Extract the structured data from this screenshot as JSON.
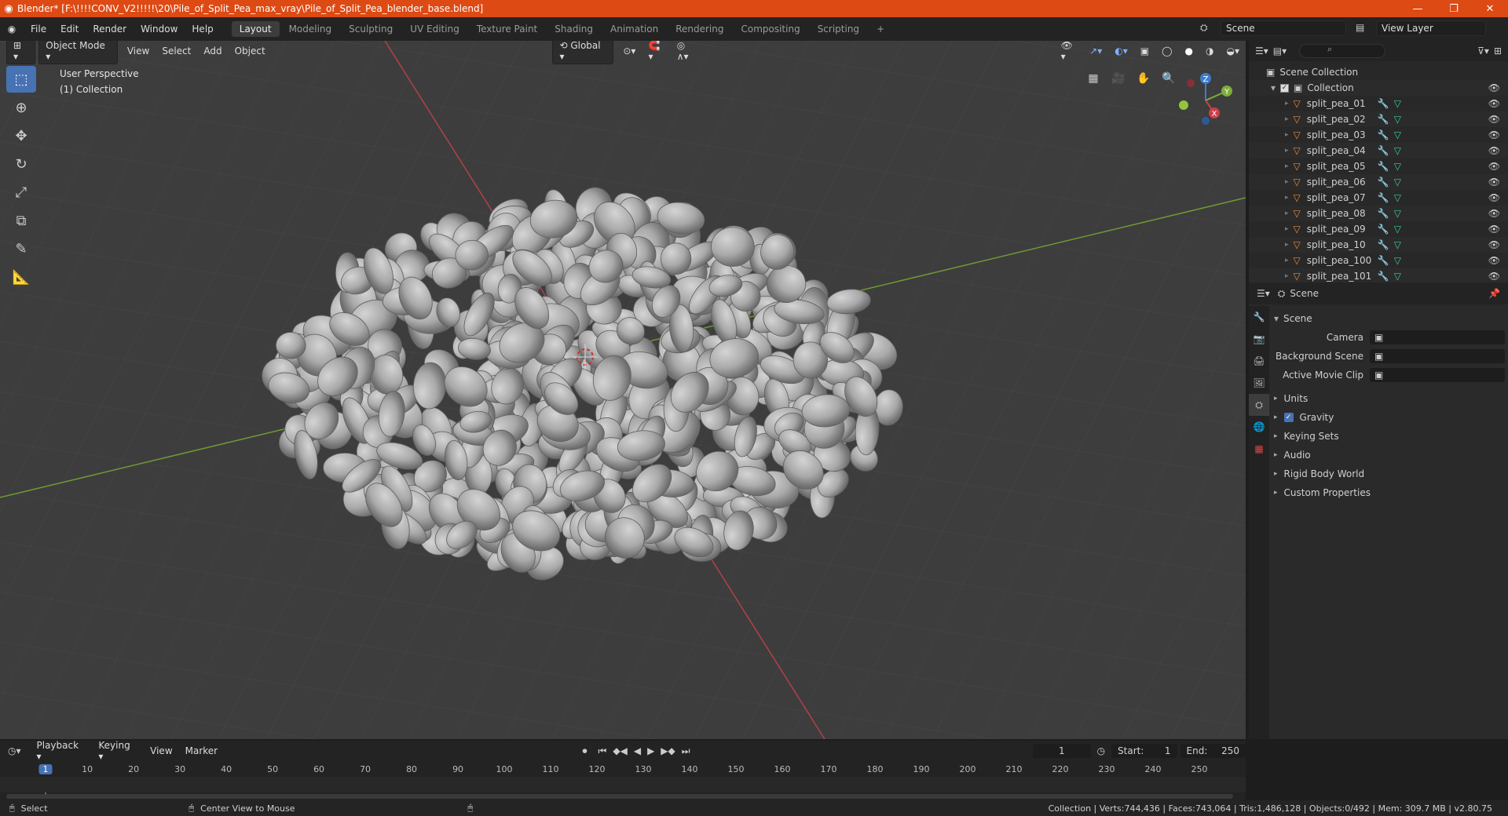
{
  "titlebar": {
    "title": "Blender* [F:\\!!!!CONV_V2!!!!!\\20\\Pile_of_Split_Pea_max_vray\\Pile_of_Split_Pea_blender_base.blend]",
    "minimize": "—",
    "maximize": "❐",
    "close": "✕"
  },
  "topbar": {
    "menus": [
      "File",
      "Edit",
      "Render",
      "Window",
      "Help"
    ],
    "workspaces": [
      "Layout",
      "Modeling",
      "Sculpting",
      "UV Editing",
      "Texture Paint",
      "Shading",
      "Animation",
      "Rendering",
      "Compositing",
      "Scripting"
    ],
    "active_workspace": "Layout",
    "add_tab": "+",
    "scene": "Scene",
    "view_layer": "View Layer"
  },
  "viewport": {
    "mode": "Object Mode",
    "menus": [
      "View",
      "Select",
      "Add",
      "Object"
    ],
    "orientation": "Global",
    "perspective_label": "User Perspective",
    "collection_label": "(1) Collection",
    "gizmo": {
      "x": "X",
      "y": "Y",
      "z": "Z"
    }
  },
  "outliner": {
    "search_placeholder": "",
    "root": "Scene Collection",
    "collection": "Collection",
    "items": [
      "split_pea_01",
      "split_pea_02",
      "split_pea_03",
      "split_pea_04",
      "split_pea_05",
      "split_pea_06",
      "split_pea_07",
      "split_pea_08",
      "split_pea_09",
      "split_pea_10",
      "split_pea_100",
      "split_pea_101"
    ]
  },
  "properties": {
    "header": "Scene",
    "section": "Scene",
    "fields": [
      {
        "label": "Camera",
        "value": ""
      },
      {
        "label": "Background Scene",
        "value": ""
      },
      {
        "label": "Active Movie Clip",
        "value": ""
      }
    ],
    "panels": [
      {
        "label": "Units",
        "checkbox": false
      },
      {
        "label": "Gravity",
        "checkbox": true
      },
      {
        "label": "Keying Sets",
        "checkbox": false
      },
      {
        "label": "Audio",
        "checkbox": false
      },
      {
        "label": "Rigid Body World",
        "checkbox": false
      },
      {
        "label": "Custom Properties",
        "checkbox": false
      }
    ]
  },
  "timeline": {
    "menus": [
      "Playback",
      "Keying",
      "View",
      "Marker"
    ],
    "current_frame": "1",
    "start_label": "Start:",
    "start": "1",
    "end_label": "End:",
    "end": "250",
    "ticks": [
      "1",
      "10",
      "20",
      "30",
      "40",
      "50",
      "60",
      "70",
      "80",
      "90",
      "100",
      "110",
      "120",
      "130",
      "140",
      "150",
      "160",
      "170",
      "180",
      "190",
      "200",
      "210",
      "220",
      "230",
      "240",
      "250"
    ]
  },
  "statusbar": {
    "left": "Select",
    "middle": "Center View to Mouse",
    "right": "Collection | Verts:744,436 | Faces:743,064 | Tris:1,486,128 | Objects:0/492 | Mem: 309.7 MB | v2.80.75"
  },
  "colors": {
    "accent": "#4772b3",
    "titlebar": "#dd4a14",
    "x_axis": "#c7414a",
    "y_axis": "#7cae3a",
    "z_axis": "#3f7ccd",
    "object_icon": "#e8893a",
    "mesh_icon": "#3dc9a9"
  }
}
